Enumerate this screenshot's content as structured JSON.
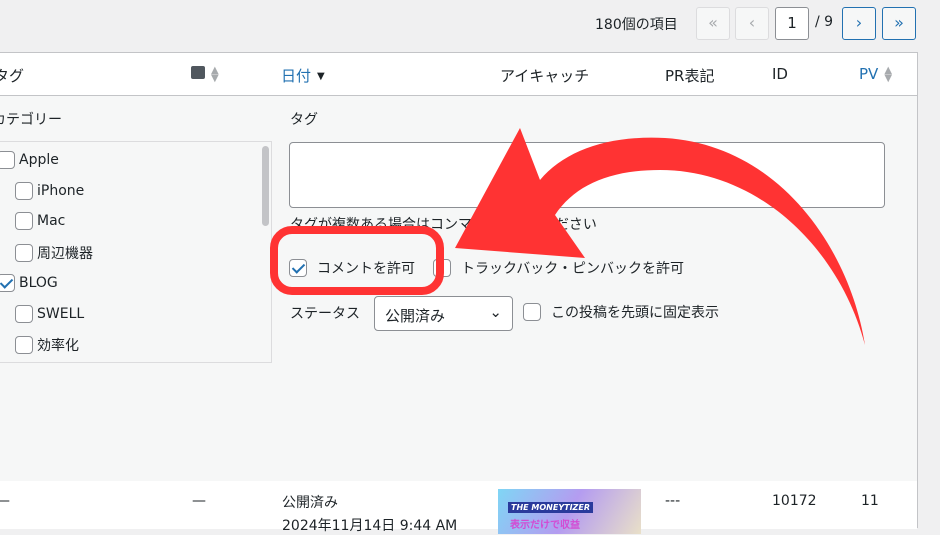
{
  "pagination": {
    "count": "180個の項目",
    "first": "«",
    "prev": "‹",
    "current": "1",
    "total": "/ 9",
    "next": "›",
    "last": "»"
  },
  "columns": {
    "tags": "タグ",
    "date": "日付",
    "eyecatch": "アイキャッチ",
    "pr": "PR表記",
    "id": "ID",
    "pv": "PV"
  },
  "quick_edit": {
    "categories_label": "カテゴリー",
    "categories": [
      {
        "label": "Apple",
        "checked": false
      },
      {
        "label": "iPhone",
        "checked": false
      },
      {
        "label": "Mac",
        "checked": false
      },
      {
        "label": "周辺機器",
        "checked": false
      },
      {
        "label": "BLOG",
        "checked": true
      },
      {
        "label": "SWELL",
        "checked": false
      },
      {
        "label": "効率化",
        "checked": false
      }
    ],
    "tags_label": "タグ",
    "tags_value": "",
    "tags_hint": "タグが複数ある場合はコンマで区切ってください",
    "allow_comments": "コメントを許可",
    "allow_pings": "トラックバック・ピンバックを許可",
    "status_label": "ステータス",
    "status_value": "公開済み",
    "sticky": "この投稿を先頭に固定表示"
  },
  "row": {
    "tags": "—",
    "comments": "—",
    "status": "公開済み",
    "date": "2024年11月14日 9:44 AM",
    "thumb_line1": "THE MONEYTIZER",
    "thumb_line2": "表示だけで収益",
    "pr": "---",
    "id": "10172",
    "pv": "11"
  },
  "colors": {
    "accent": "#2271b1",
    "annotation": "#ff3333"
  }
}
